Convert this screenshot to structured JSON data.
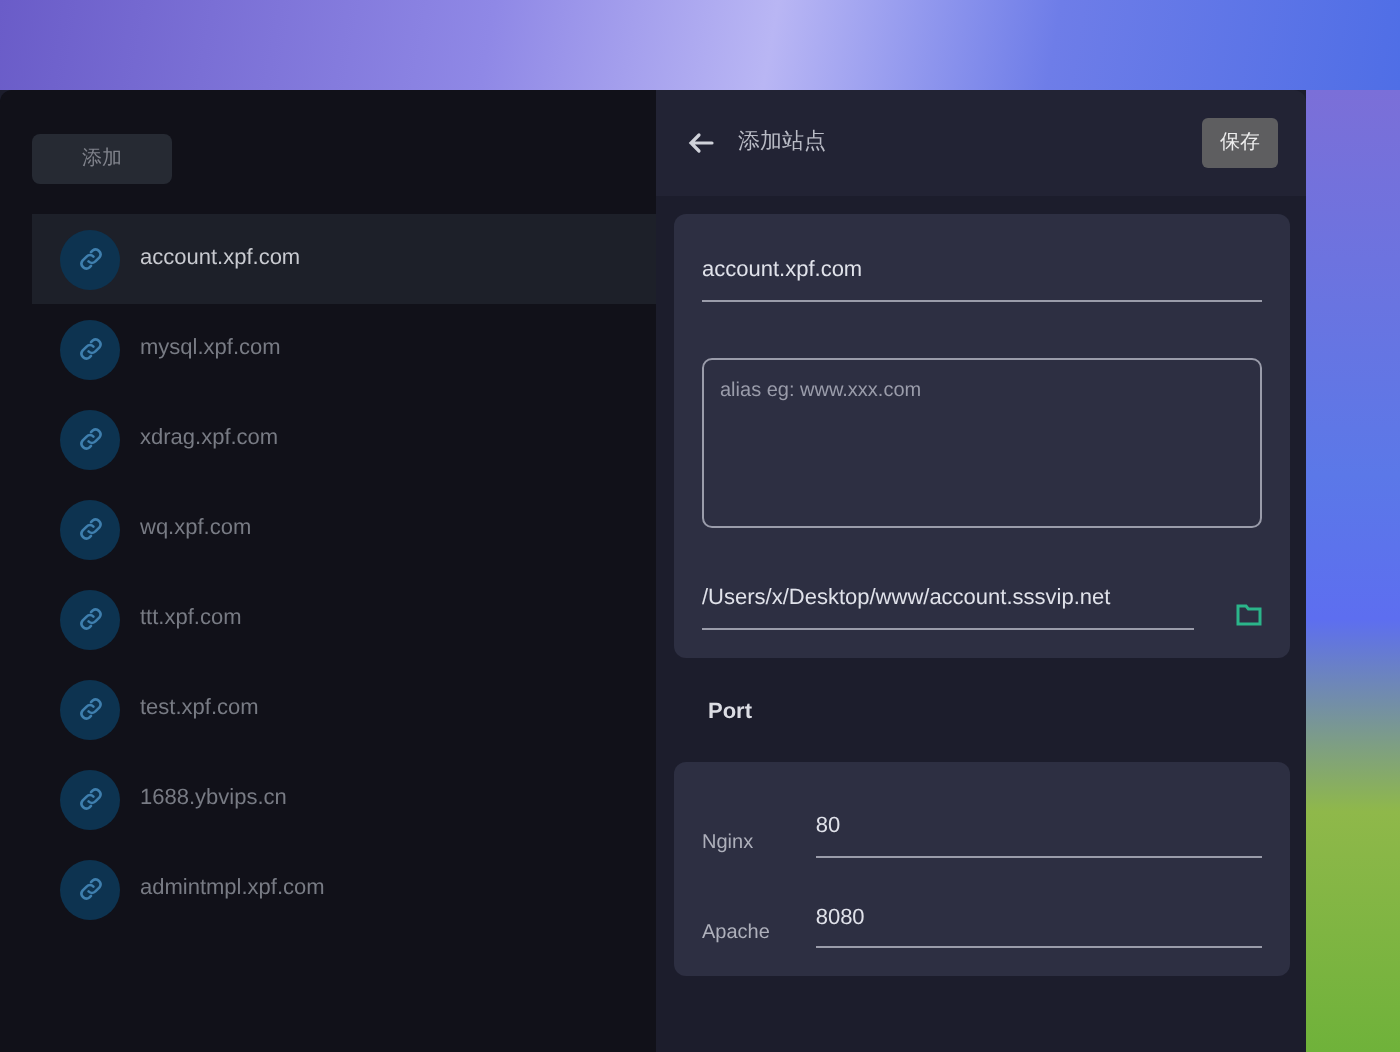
{
  "sidebar": {
    "add_button": "添加",
    "sites": [
      {
        "label": "account.xpf.com",
        "selected": true
      },
      {
        "label": "mysql.xpf.com",
        "selected": false
      },
      {
        "label": "xdrag.xpf.com",
        "selected": false
      },
      {
        "label": "wq.xpf.com",
        "selected": false
      },
      {
        "label": "ttt.xpf.com",
        "selected": false
      },
      {
        "label": "test.xpf.com",
        "selected": false
      },
      {
        "label": "1688.ybvips.cn",
        "selected": false
      },
      {
        "label": "admintmpl.xpf.com",
        "selected": false
      }
    ]
  },
  "panel": {
    "title": "添加站点",
    "save_button": "保存",
    "domain": {
      "value": "account.xpf.com"
    },
    "alias": {
      "placeholder": "alias eg: www.xxx.com"
    },
    "path": {
      "value": "/Users/x/Desktop/www/account.sssvip.net"
    },
    "port_heading": "Port",
    "ports": [
      {
        "label": "Nginx",
        "value": "80"
      },
      {
        "label": "Apache",
        "value": "8080"
      }
    ]
  }
}
